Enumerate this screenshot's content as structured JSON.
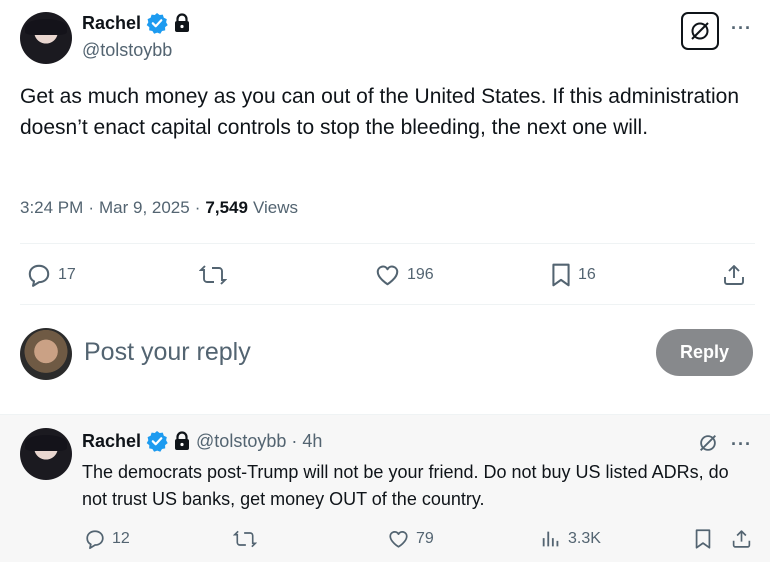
{
  "tweet": {
    "author_name": "Rachel",
    "author_handle": "@tolstoybb",
    "text": "Get as much money as you can out of the United States. If this administration doesn’t enact capital controls to stop the bleeding, the next one will.",
    "time": "3:24 PM",
    "sep1": "·",
    "date": "Mar 9, 2025",
    "sep2": "·",
    "views_count": "7,549",
    "views_label": "Views",
    "more": "···",
    "actions": {
      "replies": "17",
      "likes": "196",
      "bookmarks": "16"
    }
  },
  "composer": {
    "placeholder": "Post your reply",
    "button_label": "Reply"
  },
  "reply": {
    "author_name": "Rachel",
    "author_handle": "@tolstoybb",
    "sep": "·",
    "age": "4h",
    "more": "···",
    "text": "The democrats post-Trump will not be your friend. Do not buy US listed ADRs, do not trust US banks, get money OUT of the country.",
    "actions": {
      "replies": "12",
      "likes": "79",
      "views": "3.3K"
    }
  },
  "colors": {
    "verified": "#1d9bf0",
    "text": "#0f1419",
    "muted": "#536471",
    "reply_button": "#87898c"
  },
  "icons": [
    "verified-badge-icon",
    "lock-icon",
    "grok-icon",
    "more-icon",
    "reply-icon",
    "retweet-icon",
    "like-icon",
    "bookmark-icon",
    "share-icon",
    "views-icon"
  ]
}
